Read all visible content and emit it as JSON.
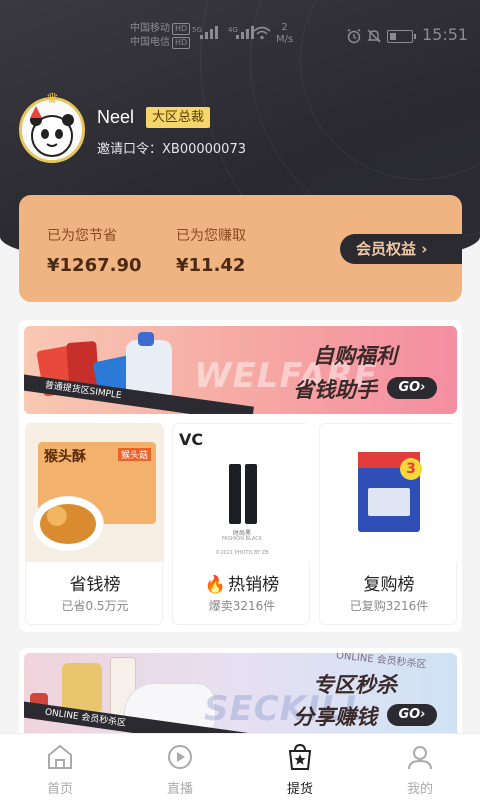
{
  "status_bar": {
    "carrier1": "中国移动",
    "carrier2": "中国电信",
    "hd": "HD",
    "net_speed": "2",
    "net_unit": "M/s",
    "sig1": "5G",
    "sig2": "4G",
    "time": "15:51"
  },
  "profile": {
    "username": "Neel",
    "rank_badge": "大区总裁",
    "invite_code": "邀请口令：XB00000073"
  },
  "earnings": {
    "saved_label": "已为您节省",
    "saved_value": "¥1267.90",
    "earned_label": "已为您赚取",
    "earned_value": "¥11.42",
    "benefits_button": "会员权益 ›"
  },
  "banner_welfare": {
    "line1": "自购福利",
    "line2": "省钱助手",
    "go": "GO›",
    "bg_word": "WELFARE",
    "tape": "普通提货区SIMPLE"
  },
  "rank_cards": [
    {
      "title": "省钱榜",
      "sub": "已省0.5万元"
    },
    {
      "title": "热销榜",
      "sub": "爆卖3216件"
    },
    {
      "title": "复购榜",
      "sub": "已复购3216件"
    }
  ],
  "rank_card_texts": {
    "biscuit_brand": "猴头酥",
    "biscuit_tag": "猴头菇",
    "fashion_logo": "VC",
    "fashion_caption": "时尚黑",
    "fashion_caption_en": "FASHION BLACK",
    "fashion_credit": "©2021 PHOTO BY ZB",
    "pack_badge": "3"
  },
  "banner_seckill": {
    "line1": "专区秒杀",
    "line2": "分享赚钱",
    "go": "GO›",
    "bg_word": "SECKILL",
    "bg_top": "ONLINE 会员秒杀区",
    "tape": "ONLINE 会员秒杀区"
  },
  "tabbar": [
    {
      "label": "首页",
      "icon": "home-icon"
    },
    {
      "label": "直播",
      "icon": "live-icon"
    },
    {
      "label": "提货",
      "icon": "shopping-bag-star-icon",
      "active": true
    },
    {
      "label": "我的",
      "icon": "profile-icon"
    }
  ],
  "colors": {
    "hero_bg": "#2c2b33",
    "earnings_card": "#f0b483",
    "badge": "#f5d66b",
    "dark_button": "#2b2a30",
    "fire": "#f2643a"
  }
}
